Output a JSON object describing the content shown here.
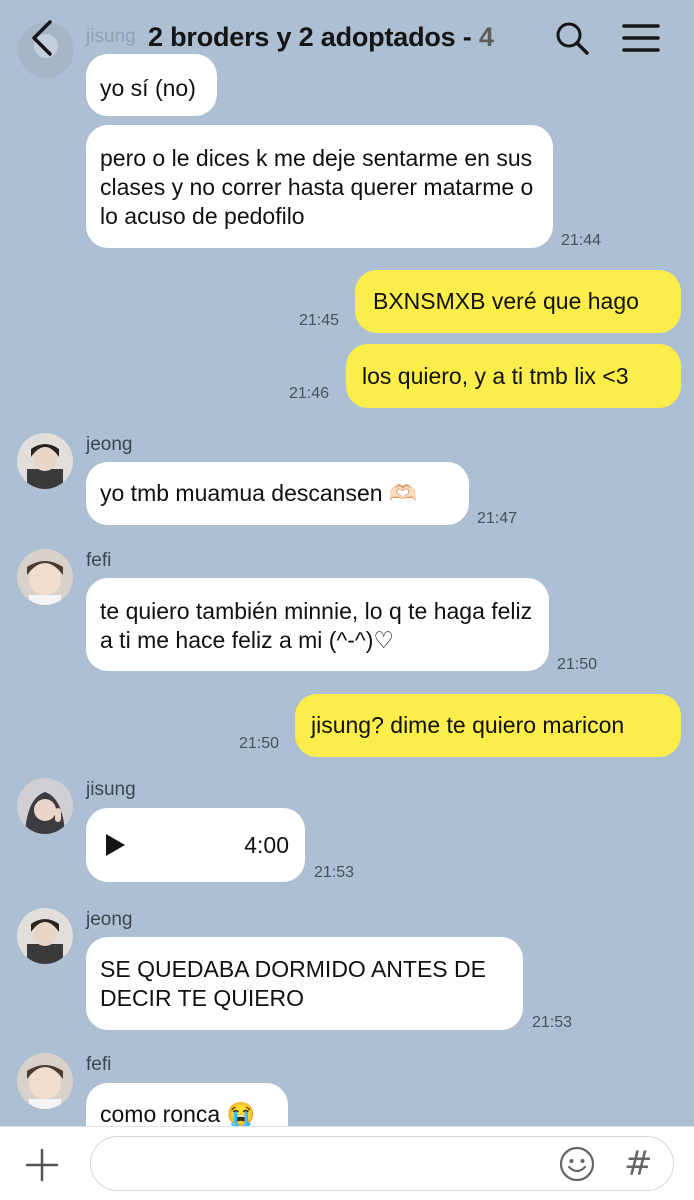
{
  "header": {
    "title": "2 broders y 2 adoptados - ",
    "member_count": "4",
    "ghost_sender": "jisung"
  },
  "messages": {
    "m1": {
      "text": "yo sí (no)"
    },
    "m2": {
      "text": "pero o le dices k me deje sentarme en sus clases y no correr hasta querer matarme o lo acuso de pedofilo",
      "time": "21:44"
    },
    "m3": {
      "text": "BXNSMXB veré que hago",
      "time": "21:45"
    },
    "m4": {
      "text": "los quiero, y a ti tmb lix <3",
      "time": "21:46"
    },
    "m5": {
      "sender": "jeong",
      "text": "yo tmb muamua descansen 🫶🏻",
      "time": "21:47"
    },
    "m6": {
      "sender": "fefi",
      "text": "te quiero también minnie, lo q te haga feliz a ti me hace feliz a mi (^-^)♡",
      "time": "21:50"
    },
    "m7": {
      "text": "jisung? dime te quiero maricon",
      "time": "21:50"
    },
    "m8": {
      "sender": "jisung",
      "duration": "4:00",
      "time": "21:53"
    },
    "m9": {
      "sender": "jeong",
      "text": "SE QUEDABA DORMIDO ANTES DE DECIR TE QUIERO",
      "time": "21:53"
    },
    "m10": {
      "sender": "fefi",
      "text": "como ronca 😭"
    }
  },
  "input": {
    "placeholder": "",
    "value": ""
  },
  "icons": {
    "back": "chevron-left-icon",
    "search": "search-icon",
    "menu": "hamburger-menu-icon",
    "plus": "plus-icon",
    "emoji": "smiley-icon",
    "hash": "hash-icon",
    "play": "play-icon"
  },
  "hash_glyph": "#",
  "colors": {
    "background": "#adbfd3",
    "incoming_bubble": "#ffffff",
    "outgoing_bubble": "#fbee4a"
  }
}
